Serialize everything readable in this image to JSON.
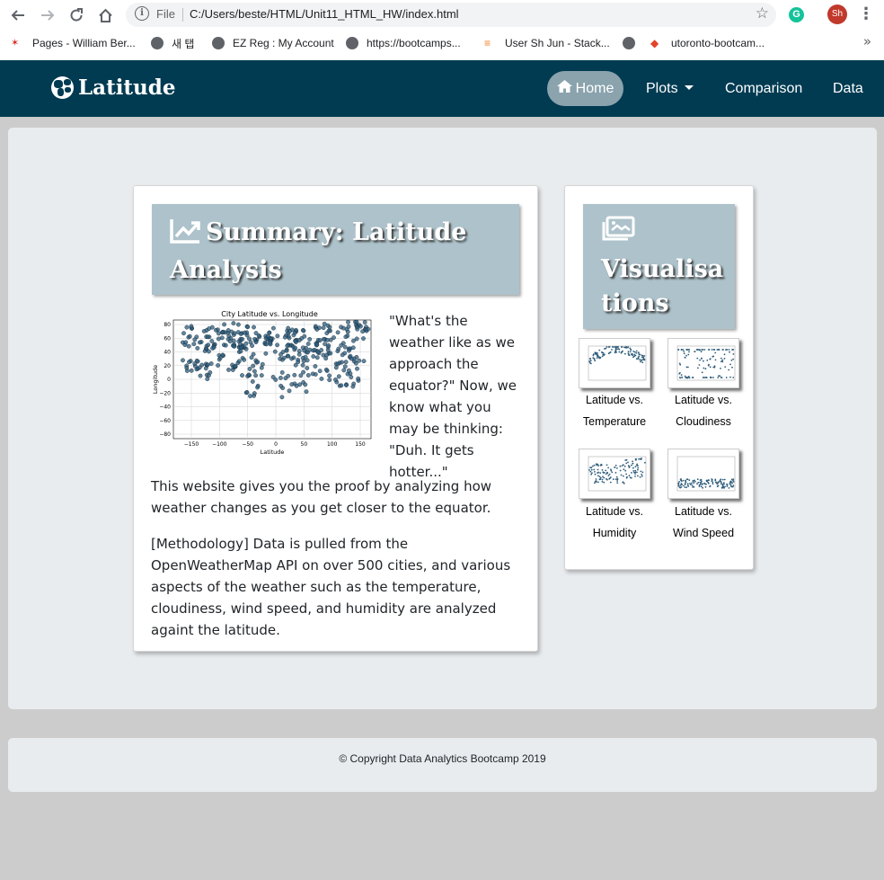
{
  "browser": {
    "back_icon": "arrow-left-icon",
    "url_scheme_label": "File",
    "url": "C:/Users/beste/HTML/Unit11_HTML_HW/index.html",
    "profile_initials": "Sh",
    "extension_letter": "G",
    "bookmarks": [
      {
        "label": "Pages - William Ber..."
      },
      {
        "label": "새 탭"
      },
      {
        "label": "EZ Reg : My Account"
      },
      {
        "label": "https://bootcamps..."
      },
      {
        "label": "User Sh Jun - Stack..."
      },
      {
        "label": "utoronto-bootcam..."
      }
    ],
    "more_bookmarks": "»"
  },
  "navbar": {
    "brand": "Latitude",
    "items": [
      {
        "label": "Home",
        "active": true
      },
      {
        "label": "Plots",
        "dropdown": true
      },
      {
        "label": "Comparison"
      },
      {
        "label": "Data"
      }
    ]
  },
  "summary": {
    "title": "Summary: Latitude Analysis",
    "plot": {
      "title": "City Latitude vs. Longitude",
      "xlabel": "Latitude",
      "ylabel": "Longitude",
      "xticks": [
        "−150",
        "−100",
        "−50",
        "0",
        "50",
        "100",
        "150"
      ],
      "yticks": [
        "80",
        "60",
        "40",
        "20",
        "0",
        "−20",
        "−40",
        "−60",
        "−80"
      ]
    },
    "quote": "\"What's the weather like as we approach the equator?\" Now, we know what you may be thinking: \"Duh. It gets hotter...\"",
    "paragraph1": "This website gives you the proof by analyzing how weather changes as you get closer to the equator.",
    "paragraph2": "[Methodology] Data is pulled from the OpenWeatherMap API on over 500 cities, and various aspects of the weather such as the temperature, cloudiness, wind speed, and humidity are analyzed againt the latitude."
  },
  "visualisations": {
    "title": "Visualisations",
    "items": [
      {
        "label_line1": "Latitude vs.",
        "label_line2": "Temperature"
      },
      {
        "label_line1": "Latitude vs.",
        "label_line2": "Cloudiness"
      },
      {
        "label_line1": "Latitude vs.",
        "label_line2": "Humidity"
      },
      {
        "label_line1": "Latitude vs.",
        "label_line2": "Wind Speed"
      }
    ]
  },
  "footer": {
    "text": "© Copyright Data Analytics Bootcamp 2019"
  },
  "colors": {
    "navbar_bg": "#003b52",
    "home_pill": "#8aa3ad",
    "title_box": "#adc2ca",
    "scatter_point": "#2f5d7c"
  }
}
